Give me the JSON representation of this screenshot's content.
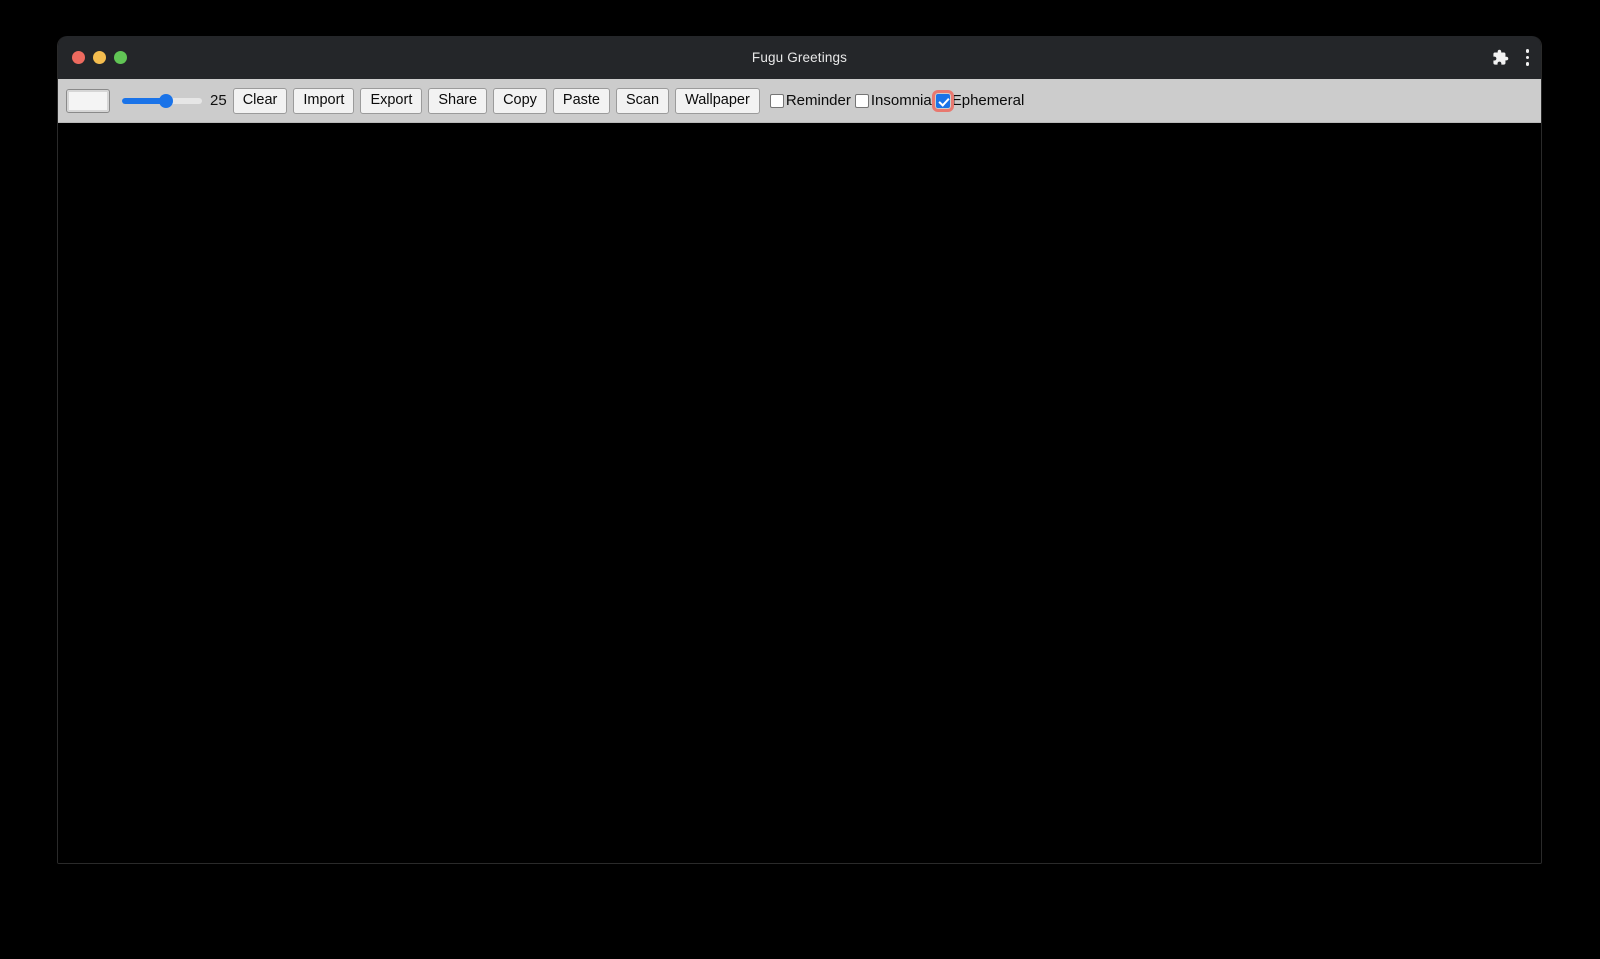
{
  "window": {
    "title": "Fugu Greetings",
    "traffic_lights": [
      {
        "name": "close",
        "color": "#ed6a5f"
      },
      {
        "name": "minimize",
        "color": "#f4bd4f"
      },
      {
        "name": "maximize",
        "color": "#61c555"
      }
    ],
    "actions": [
      {
        "name": "extensions-icon",
        "icon": "puzzle-piece"
      },
      {
        "name": "menu-icon",
        "icon": "three-dots-vertical"
      }
    ]
  },
  "toolbar": {
    "color_picker": {
      "label": "color-swatch",
      "value": "#f4f4f4"
    },
    "thickness": {
      "label": "thickness-slider",
      "value": "25",
      "min": "1",
      "max": "100",
      "fill_color": "#1a73e8",
      "track_color": "#e6e6e6"
    },
    "buttons": [
      {
        "name": "clear-button",
        "label": "Clear"
      },
      {
        "name": "import-button",
        "label": "Import"
      },
      {
        "name": "export-button",
        "label": "Export"
      },
      {
        "name": "share-button",
        "label": "Share"
      },
      {
        "name": "copy-button",
        "label": "Copy"
      },
      {
        "name": "paste-button",
        "label": "Paste"
      },
      {
        "name": "scan-button",
        "label": "Scan"
      },
      {
        "name": "wallpaper-button",
        "label": "Wallpaper"
      }
    ],
    "checkboxes": [
      {
        "name": "reminder-checkbox",
        "label": "Reminder",
        "checked": false,
        "focused": false
      },
      {
        "name": "insomnia-checkbox",
        "label": "Insomnia",
        "checked": false,
        "focused": false
      },
      {
        "name": "ephemeral-checkbox",
        "label": "Ephemeral",
        "checked": true,
        "focused": true
      }
    ]
  },
  "canvas": {
    "name": "drawing-canvas",
    "background": "#000000",
    "content": ""
  },
  "colors": {
    "titlebar_bg": "#242629",
    "toolbar_bg": "#cccccc",
    "accent": "#1a73e8",
    "focus_ring": "#e8786f",
    "desktop_bg": "#000000"
  }
}
